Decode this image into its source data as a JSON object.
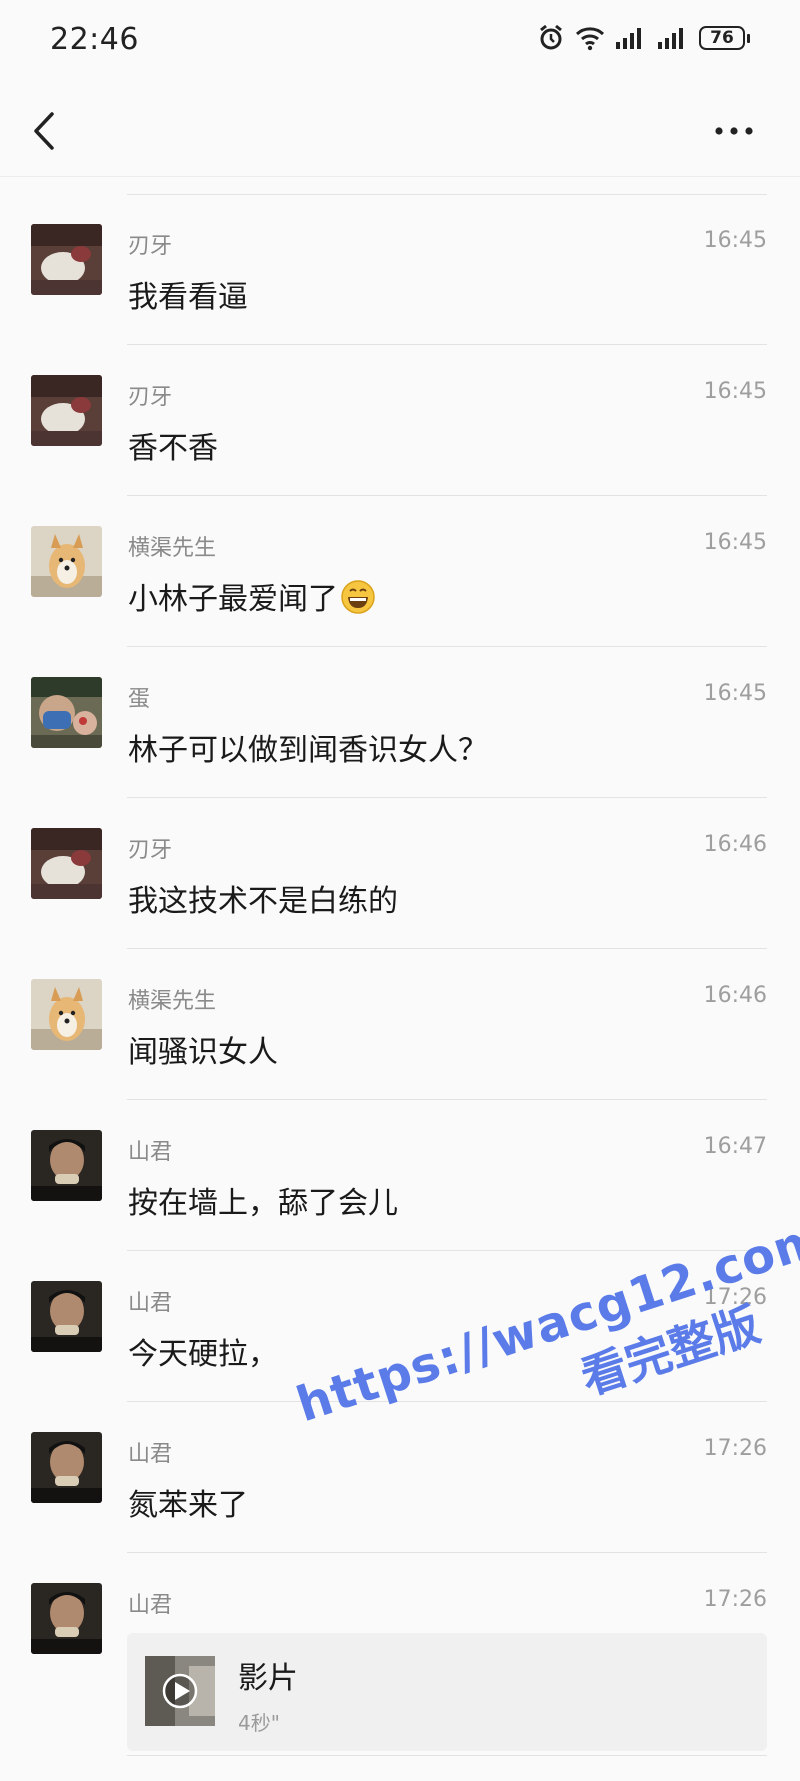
{
  "status_bar": {
    "time": "22:46",
    "battery": "76"
  },
  "nav": {
    "back_icon": "chevron-left-icon",
    "more_icon": "more-horizontal-icon"
  },
  "messages": [
    {
      "sender": "刃牙",
      "time": "16:45",
      "text": "我看看逼",
      "avatar": "renya"
    },
    {
      "sender": "刃牙",
      "time": "16:45",
      "text": "香不香",
      "avatar": "renya"
    },
    {
      "sender": "横渠先生",
      "time": "16:45",
      "text": "小林子最爱闻了",
      "emoji": "grinning-face-emoji",
      "avatar": "dog"
    },
    {
      "sender": "蛋",
      "time": "16:45",
      "text": "林子可以做到闻香识女人？",
      "avatar": "dan"
    },
    {
      "sender": "刃牙",
      "time": "16:46",
      "text": "我这技术不是白练的",
      "avatar": "renya"
    },
    {
      "sender": "横渠先生",
      "time": "16:46",
      "text": "闻骚识女人",
      "avatar": "dog"
    },
    {
      "sender": "山君",
      "time": "16:47",
      "text": "按在墙上，舔了会儿",
      "avatar": "shanjun"
    },
    {
      "sender": "山君",
      "time": "17:26",
      "text": "今天硬拉，",
      "avatar": "shanjun"
    },
    {
      "sender": "山君",
      "time": "17:26",
      "text": "氮苯来了",
      "avatar": "shanjun"
    },
    {
      "sender": "山君",
      "time": "17:26",
      "video": {
        "title": "影片",
        "duration": "4秒\""
      },
      "avatar": "shanjun"
    }
  ],
  "watermark": {
    "url": "https://wacg12.com",
    "subtitle": "看完整版"
  },
  "colors": {
    "background": "#fafafa",
    "watermark": "#5a7be8",
    "meta_text": "#8a8a8a"
  }
}
